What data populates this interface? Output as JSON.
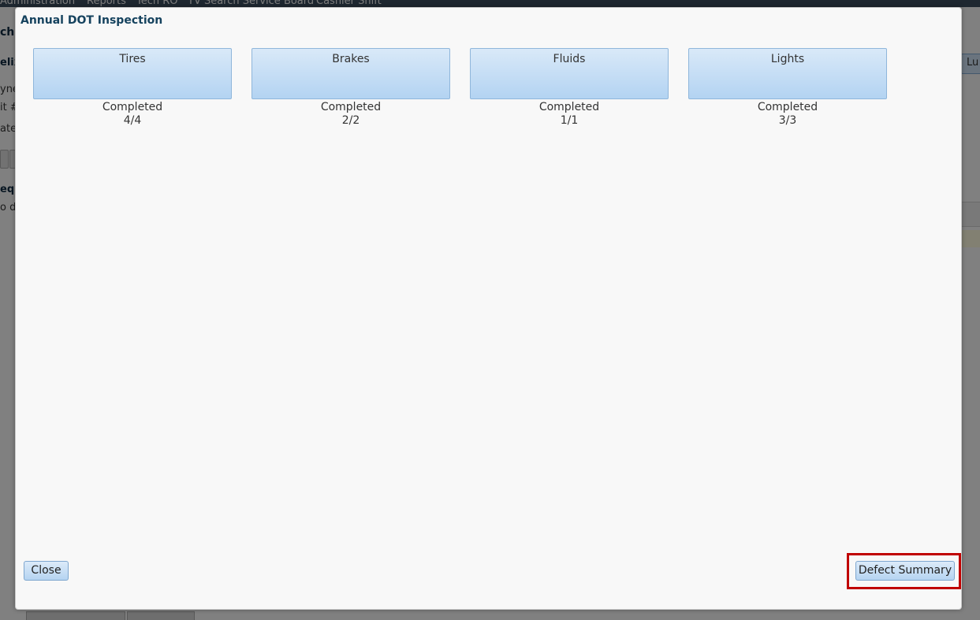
{
  "background": {
    "menu": [
      "Administration",
      "Reports",
      "Tech RO",
      "TV Search Service Board",
      "Cashier Shift"
    ],
    "fragments": [
      "ch",
      "elix",
      "yner",
      "it #",
      "ate",
      "equ",
      "o d",
      "Lu"
    ]
  },
  "dialog": {
    "title": "Annual DOT Inspection",
    "categories": [
      {
        "label": "Tires",
        "status": "Completed",
        "progress": "4/4"
      },
      {
        "label": "Brakes",
        "status": "Completed",
        "progress": "2/2"
      },
      {
        "label": "Fluids",
        "status": "Completed",
        "progress": "1/1"
      },
      {
        "label": "Lights",
        "status": "Completed",
        "progress": "3/3"
      }
    ],
    "close_label": "Close",
    "defect_summary_label": "Defect Summary"
  },
  "colors": {
    "title": "#15425e",
    "button_border": "#8fb6db",
    "highlight": "#c00000"
  }
}
